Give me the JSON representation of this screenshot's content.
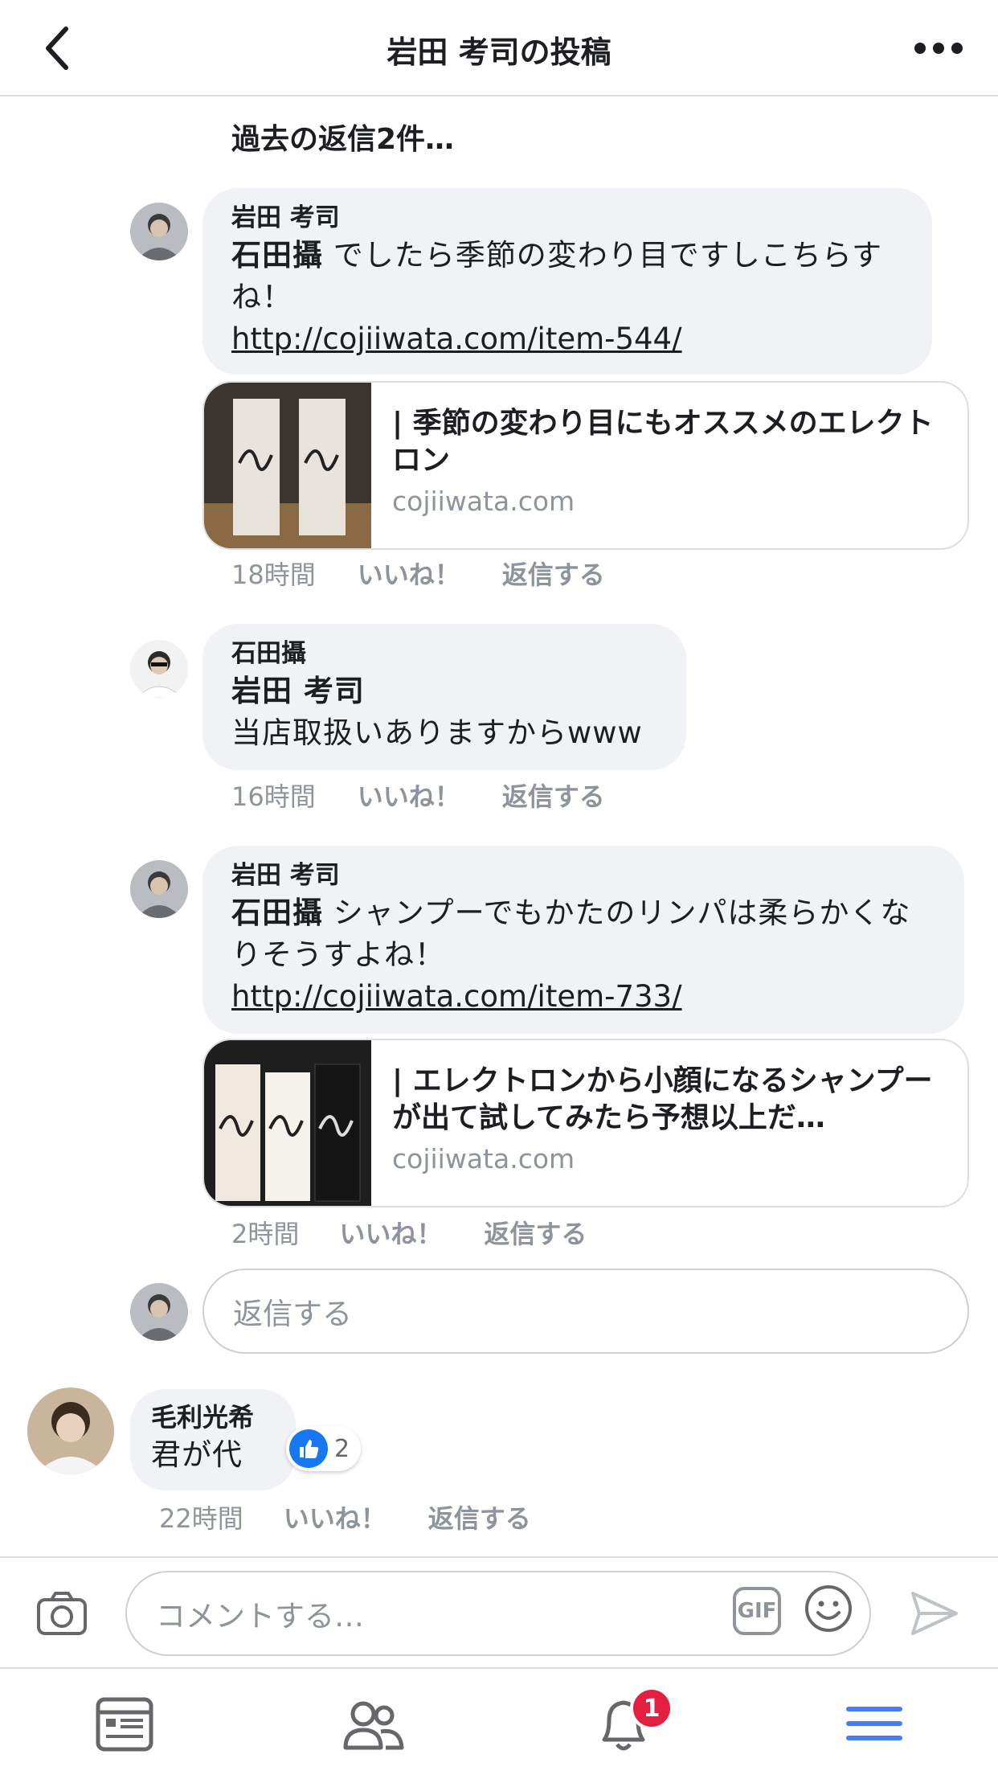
{
  "header": {
    "title": "岩田 考司の投稿"
  },
  "prev_replies": "過去の返信2件…",
  "replies": [
    {
      "author": "岩田 考司",
      "mention": "石田攝",
      "text_line1": " でしたら季節の変わり目ですしこちらす",
      "text_line2": "ね！",
      "link": "http://cojiiwata.com/item-544/",
      "card_title": "| 季節の変わり目にもオススメのエレクトロン",
      "card_domain": "cojiiwata.com",
      "time": "18時間",
      "like_label": "いいね！",
      "reply_label": "返信する"
    },
    {
      "author": "石田攝",
      "mention": "岩田 考司",
      "text_line1": "当店取扱いありますからwww",
      "time": "16時間",
      "like_label": "いいね！",
      "reply_label": "返信する"
    },
    {
      "author": "岩田 考司",
      "mention": "石田攝",
      "text_line1": " シャンプーでもかたのリンパは柔らかくな",
      "text_line2": "りそうすよね！",
      "link": "http://cojiiwata.com/item-733/",
      "card_title": "| エレクトロンから小顔になるシャンプーが出て試してみたら予想以上だ…",
      "card_domain": "cojiiwata.com",
      "time": "2時間",
      "like_label": "いいね！",
      "reply_label": "返信する"
    }
  ],
  "reply_input": {
    "placeholder": "返信する"
  },
  "comment": {
    "author": "毛利光希",
    "text": "君が代",
    "like_count": "2",
    "time": "22時間",
    "like_label": "いいね！",
    "reply_label": "返信する"
  },
  "composer": {
    "placeholder": "コメントする…",
    "gif_label": "GIF"
  },
  "tabbar": {
    "notification_count": "1",
    "icons": [
      "news-feed-icon",
      "friends-icon",
      "notifications-icon",
      "menu-icon"
    ],
    "active_color": "#4a7bf7"
  }
}
